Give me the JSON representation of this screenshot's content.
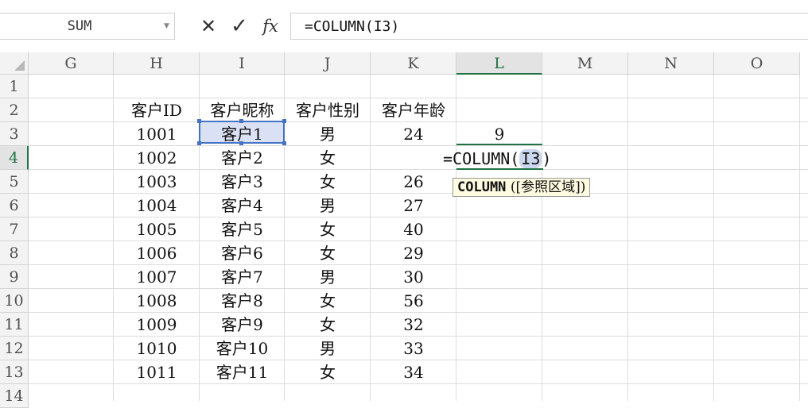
{
  "name_box": {
    "value": "SUM"
  },
  "formula_bar": {
    "cancel_glyph": "✕",
    "confirm_glyph": "✓",
    "fx_label": "fx",
    "formula": "=COLUMN(I3)"
  },
  "columns": [
    "G",
    "H",
    "I",
    "J",
    "K",
    "L",
    "M",
    "N",
    "O"
  ],
  "selected_column": "L",
  "rows": [
    "1",
    "2",
    "3",
    "4",
    "5",
    "6",
    "7",
    "8",
    "9",
    "10",
    "11",
    "12",
    "13",
    "14"
  ],
  "selected_row": "4",
  "headers": {
    "h": "客户ID",
    "i": "客户昵称",
    "j": "客户性别",
    "k": "客户年龄"
  },
  "data_rows": [
    {
      "id": "1001",
      "nick": "客户1",
      "sex": "男",
      "age": "24"
    },
    {
      "id": "1002",
      "nick": "客户2",
      "sex": "女",
      "age": ""
    },
    {
      "id": "1003",
      "nick": "客户3",
      "sex": "女",
      "age": "26"
    },
    {
      "id": "1004",
      "nick": "客户4",
      "sex": "男",
      "age": "27"
    },
    {
      "id": "1005",
      "nick": "客户5",
      "sex": "女",
      "age": "40"
    },
    {
      "id": "1006",
      "nick": "客户6",
      "sex": "女",
      "age": "29"
    },
    {
      "id": "1007",
      "nick": "客户7",
      "sex": "男",
      "age": "30"
    },
    {
      "id": "1008",
      "nick": "客户8",
      "sex": "女",
      "age": "56"
    },
    {
      "id": "1009",
      "nick": "客户9",
      "sex": "女",
      "age": "32"
    },
    {
      "id": "1010",
      "nick": "客户10",
      "sex": "男",
      "age": "33"
    },
    {
      "id": "1011",
      "nick": "客户11",
      "sex": "女",
      "age": "34"
    }
  ],
  "l3_value": "9",
  "editing": {
    "prefix": "=COLUMN(",
    "ref": "I3",
    "suffix": ")"
  },
  "tooltip": {
    "func": "COLUMN",
    "args": "([参照区域])"
  },
  "colors": {
    "accent": "#217346",
    "selection": "#4472c4",
    "selection_fill": "#dae1f4",
    "tooltip_bg": "#fffbe0"
  }
}
